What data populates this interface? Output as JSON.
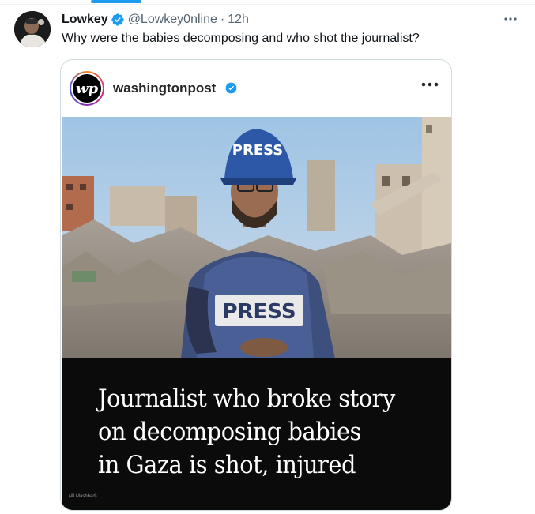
{
  "tweet": {
    "display_name": "Lowkey",
    "handle": "@Lowkey0nline",
    "separator": "·",
    "time": "12h",
    "text": "Why were the babies decomposing and who shot the journalist?",
    "more_icon": "more-horizontal-icon"
  },
  "embed": {
    "account_name": "washingtonpost",
    "logo_text": "wp",
    "more_icon": "more-horizontal-icon",
    "photo_helmet_text": "PRESS",
    "photo_vest_text": "PRESS",
    "headline_lines": [
      "Journalist who broke story",
      "on decomposing babies",
      "in Gaza is shot, injured"
    ],
    "photo_credit": "(Al Mashhad)"
  },
  "colors": {
    "accent": "#1d9bf0",
    "text_primary": "#0f1419",
    "text_secondary": "#536471",
    "caption_bg": "#0b0b0b"
  }
}
